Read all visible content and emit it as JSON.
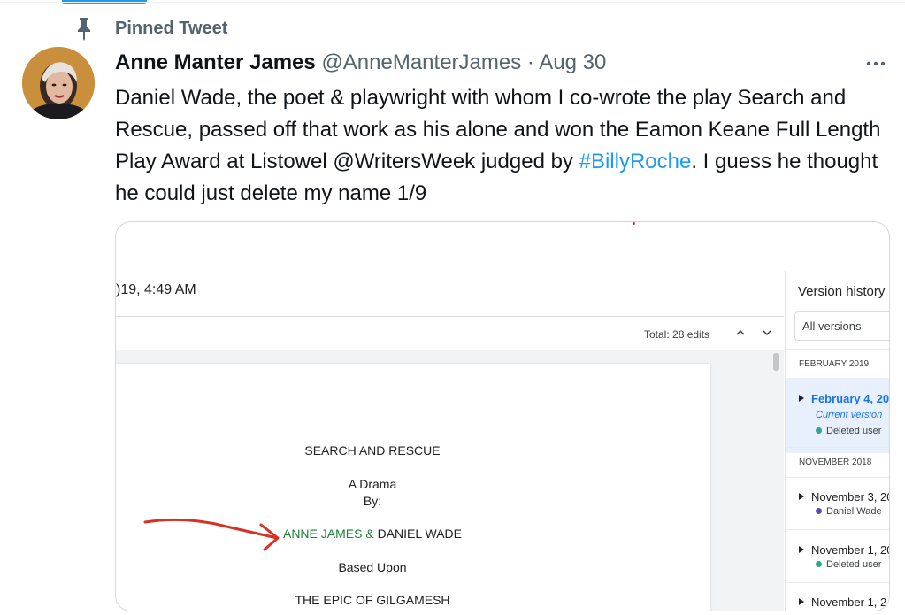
{
  "pinned": {
    "label": "Pinned Tweet"
  },
  "tweet": {
    "display_name": "Anne Manter James",
    "handle": "@AnneManterJames",
    "separator": "·",
    "date": "Aug 30",
    "text_before": "Daniel Wade, the poet & playwright with whom I co-wrote the play Search and Rescue, passed off that work as his alone and won the Eamon Keane Full Length Play Award at Listowel @WritersWeek judged by ",
    "hashtag": "#BillyRoche",
    "text_after": ". I guess he thought he could just delete my name 1/9"
  },
  "media": {
    "doc_timestamp": ")19, 4:49 AM",
    "total_edits": "Total: 28 edits",
    "document": {
      "title": "SEARCH AND RESCUE",
      "subtitle": "A Drama",
      "by": "By:",
      "struck_author": "ANNE JAMES & ",
      "author": "DANIEL WADE",
      "based_upon": "Based Upon",
      "source": "THE EPIC OF GILGAMESH"
    },
    "version_history": {
      "title": "Version history",
      "filter": "All versions",
      "groups": [
        {
          "month": "FEBRUARY 2019"
        },
        {
          "month": "NOVEMBER 2018"
        }
      ],
      "entries": [
        {
          "date": "February 4, 20",
          "current": "Current version",
          "user": "Deleted user",
          "user_color": "#33a68f"
        },
        {
          "date": "November 3, 20",
          "user": "Daniel Wade",
          "user_color": "#5c4bb5"
        },
        {
          "date": "November 1, 20",
          "user": "Deleted user",
          "user_color": "#33a68f"
        },
        {
          "date": "November 1, 2"
        }
      ]
    }
  },
  "colors": {
    "link": "#1d9bf0",
    "muted": "#536471",
    "arrow": "#d93025",
    "strike": "#188038"
  }
}
